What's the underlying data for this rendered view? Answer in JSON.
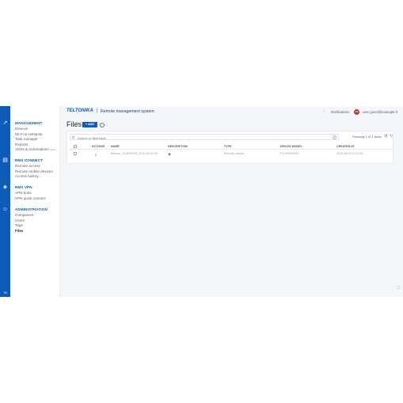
{
  "rail": {
    "icons": [
      "chart-icon",
      "devices-icon",
      "shield-icon",
      "users-icon"
    ],
    "footer": "76"
  },
  "nav": {
    "sections": [
      {
        "title": "MANAGEMENT",
        "items": [
          "Devices",
          "Wi-Fi & Hotspots",
          "Task manager",
          "Reports",
          "Alerts & Automations"
        ],
        "beta": "(beta)"
      },
      {
        "title": "RMS CONNECT",
        "items": [
          "Remote access",
          "Remote mobile devices",
          "Access history"
        ]
      },
      {
        "title": "RMS VPN",
        "items": [
          "VPN hubs",
          "VPN quick connect"
        ]
      },
      {
        "title": "ADMINISTRATION",
        "items": [
          "Companies",
          "Users",
          "Tags",
          "Files"
        ]
      }
    ],
    "active": "Files"
  },
  "topbar": {
    "logo": "TELTONIKA",
    "separator": "|",
    "subtitle": "Remote management system",
    "notifications": "Notifications",
    "avatar": "AB",
    "user": "user.guest@example.lt"
  },
  "page": {
    "title": "Files",
    "add_label": "+ ADD",
    "info": "i"
  },
  "toolbar": {
    "search_placeholder": "Search or filter table...",
    "help": "?",
    "showing": "Showing 1 of 1 items"
  },
  "table": {
    "columns": [
      "ACTIONS",
      "NAME",
      "DESCRIPTION",
      "TYPE",
      "DEVICE MODEL",
      "CREATED AT"
    ],
    "rows": [
      {
        "name": "Backup_1118099490_2024-06-02-09...",
        "type": "Remote backup",
        "device_model": "RUT00000000",
        "created_at": "2024-06-02 07:31:33"
      }
    ]
  },
  "colors": {
    "brand": "#0e5cb6",
    "rail": "#0e5cb6",
    "background": "#f4f6f9"
  }
}
